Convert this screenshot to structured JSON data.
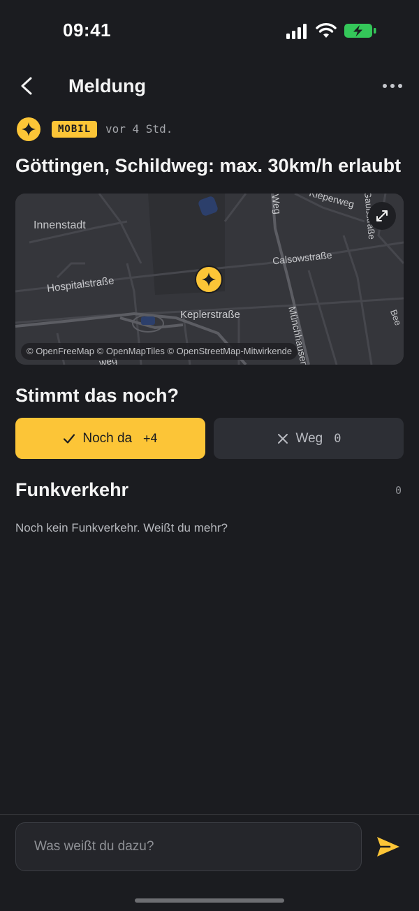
{
  "status_bar": {
    "time": "09:41",
    "icons": [
      "signal-icon",
      "wifi-icon",
      "battery-charging-icon"
    ],
    "battery_color": "#34c759"
  },
  "header": {
    "title": "Meldung",
    "back_icon": "chevron-left-icon",
    "menu_icon": "more-horizontal-icon"
  },
  "report": {
    "category_icon": "sparkle-icon",
    "category_label": "MOBIL",
    "time_ago": "vor 4 Std.",
    "title": "Göttingen, Schildweg: max. 30km/h erlaubt"
  },
  "map": {
    "labels": {
      "district": "Innenstadt",
      "street_hospital": "Hospitalstraße",
      "street_kepler": "Keplerstraße",
      "street_calsow": "Calsowstraße",
      "street_kieper": "Kieperweg",
      "street_muenchhausen": "Münchhausenstraße",
      "street_weg_top": "Weg",
      "street_weg_bottom": "weg",
      "street_gauss": "Gaußstraße",
      "street_bee": "Bee"
    },
    "attribution": "© OpenFreeMap © OpenMapTiles © OpenStreetMap-Mitwirkende",
    "expand_icon": "expand-icon",
    "pin_icon": "sparkle-icon"
  },
  "verification": {
    "heading": "Stimmt das noch?",
    "still_there_label": "Noch da",
    "still_there_count": "+4",
    "gone_label": "Weg",
    "gone_count": "0"
  },
  "comments": {
    "heading": "Funkverkehr",
    "count": "0",
    "empty_text": "Noch kein Funkverkehr. Weißt du mehr?"
  },
  "input": {
    "placeholder": "Was weißt du dazu?",
    "send_icon": "send-icon"
  },
  "colors": {
    "accent": "#fcc537",
    "background": "#1b1c20",
    "surface": "#2d2f35"
  }
}
